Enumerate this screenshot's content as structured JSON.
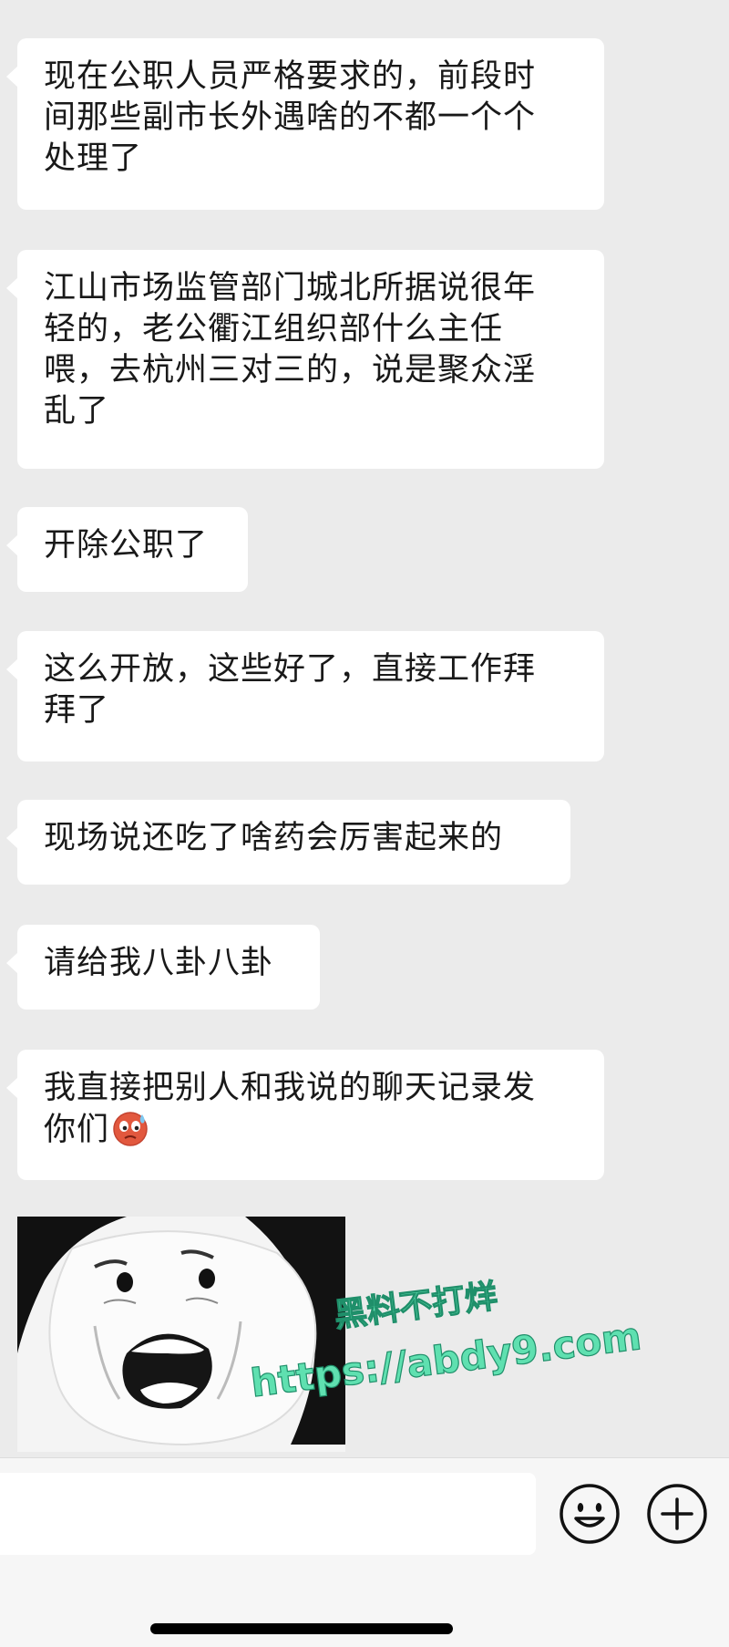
{
  "messages": [
    {
      "lines": [
        "现在公职人员严格要求的，前段时",
        "间那些副市长外遇啥的不都一个个",
        "处理了"
      ]
    },
    {
      "lines": [
        "江山市场监管部门城北所据说很年",
        "轻的，老公衢江组织部什么主任",
        "喂，去杭州三对三的，说是聚众淫",
        "乱了"
      ]
    },
    {
      "lines": [
        "开除公职了"
      ]
    },
    {
      "lines": [
        "这么开放，这些好了，直接工作拜",
        "拜了"
      ]
    },
    {
      "lines": [
        "现场说还吃了啥药会厉害起来的"
      ]
    },
    {
      "lines": [
        "请给我八卦八卦"
      ]
    },
    {
      "lines": [
        "我直接把别人和我说的聊天记录发",
        "你们"
      ],
      "trailing_emoji": "sweating-face-emoji"
    }
  ],
  "sticker": {
    "icon": "panda-meme-sticker"
  },
  "watermark": {
    "line1": "黑料不打烊",
    "line2": "https://abdy9.com",
    "color": "#5fe0b0"
  },
  "input_bar": {
    "input_value": "",
    "emoji_button_icon": "smiley-icon",
    "plus_button_icon": "plus-circle-icon"
  },
  "colors": {
    "chat_background": "#ebebeb",
    "bubble": "#ffffff",
    "text": "#191919",
    "bar_background": "#f6f6f6"
  }
}
